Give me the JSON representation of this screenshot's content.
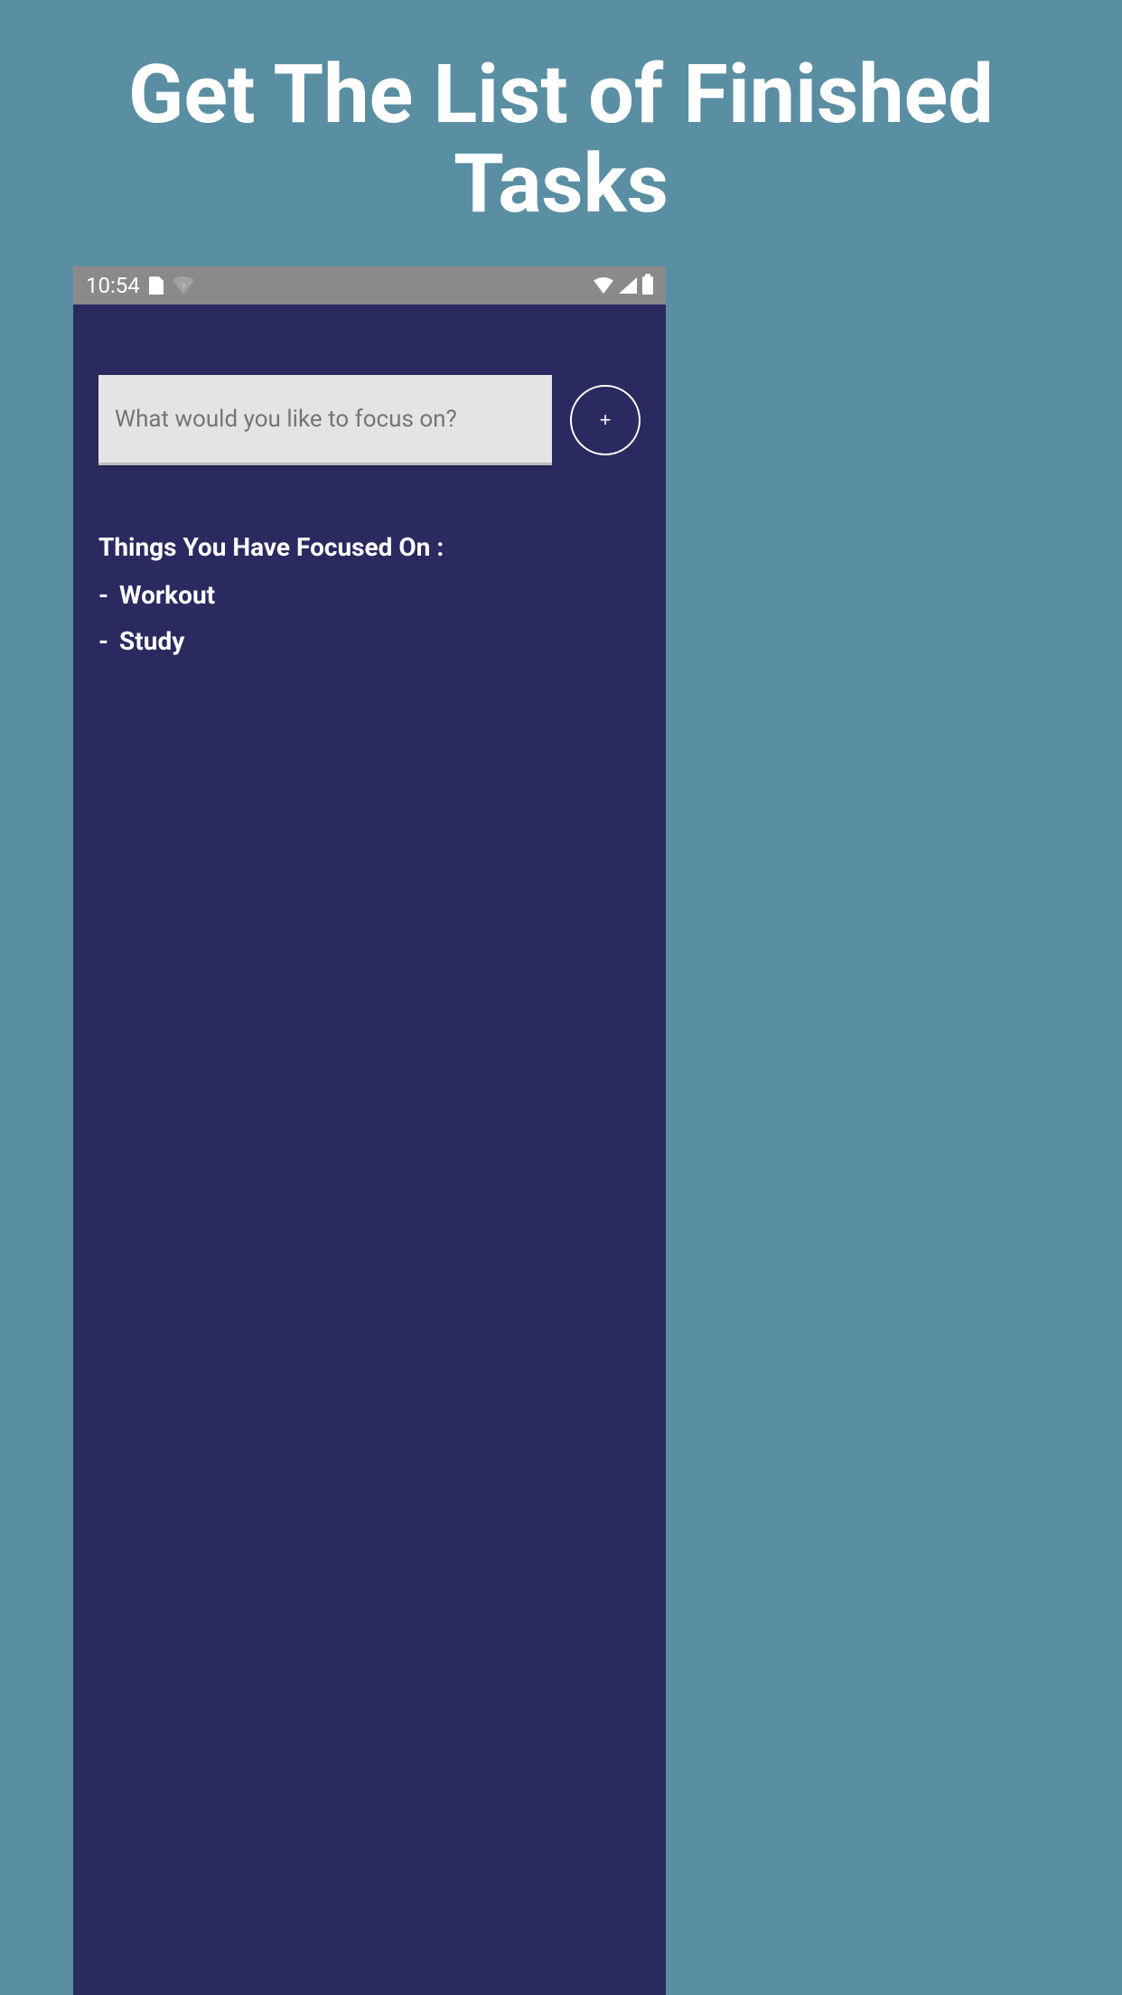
{
  "promo": {
    "title": "Get The List of Finished Tasks"
  },
  "status_bar": {
    "time": "10:54"
  },
  "input": {
    "placeholder": "What would you like to focus on?",
    "value": ""
  },
  "add_button": {
    "label": "+"
  },
  "section": {
    "heading": "Things You Have Focused On :"
  },
  "tasks": [
    {
      "bullet": "-",
      "label": "Workout"
    },
    {
      "bullet": "-",
      "label": "Study"
    }
  ]
}
